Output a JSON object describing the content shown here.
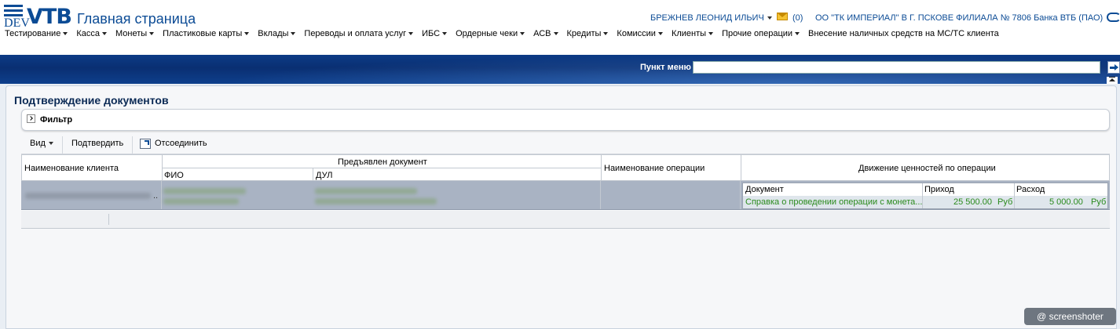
{
  "brand": {
    "dev": "DEV",
    "vtb": "VTB"
  },
  "header": {
    "title": "Главная страница",
    "user": "БРЕЖНЕВ ЛЕОНИД ИЛЬИЧ",
    "mail_count": "(0)",
    "org": "ОО \"ТК ИМПЕРИАЛ\" В Г. ПСКОВЕ ФИЛИАЛА № 7806 Банка ВТБ (ПАО)"
  },
  "menu": [
    {
      "label": "Тестирование",
      "caret": true
    },
    {
      "label": "Касса",
      "caret": true
    },
    {
      "label": "Монеты",
      "caret": true
    },
    {
      "label": "Пластиковые карты",
      "caret": true
    },
    {
      "label": "Вклады",
      "caret": true
    },
    {
      "label": "Переводы и оплата услуг",
      "caret": true
    },
    {
      "label": "ИБС",
      "caret": true
    },
    {
      "label": "Ордерные чеки",
      "caret": true
    },
    {
      "label": "АСВ",
      "caret": true
    },
    {
      "label": "Кредиты",
      "caret": true
    },
    {
      "label": "Комиссии",
      "caret": true
    },
    {
      "label": "Клиенты",
      "caret": true
    },
    {
      "label": "Прочие операции",
      "caret": true
    },
    {
      "label": "Внесение наличных средств на МС/ТС клиента",
      "caret": false
    }
  ],
  "menu_search": {
    "label": "Пункт меню",
    "value": ""
  },
  "page": {
    "section_title": "Подтверждение документов",
    "filter_label": "Фильтр"
  },
  "toolbar": {
    "view": "Вид",
    "confirm": "Подтвердить",
    "detach": "Отсоединить"
  },
  "table": {
    "headers": {
      "client": "Наименование клиента",
      "presented_doc": "Предъявлен документ",
      "fio": "ФИО",
      "dul": "ДУЛ",
      "operation": "Наименование операции",
      "movement": "Движение ценностей по операции"
    },
    "client_suffix": "..",
    "sub_headers": {
      "document": "Документ",
      "income": "Приход",
      "expense": "Расход"
    },
    "sub_row": {
      "document": "Справка о проведении операции с монета...",
      "income": "25 500.00",
      "income_currency": "Руб",
      "expense": "5 000.00",
      "expense_currency": "Руб"
    }
  },
  "watermark": "@ screenshoter"
}
